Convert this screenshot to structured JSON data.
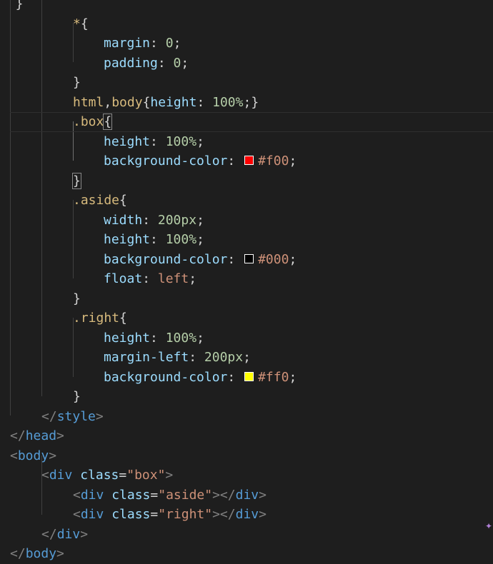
{
  "lines": [
    {
      "indent": 0,
      "tokens": [
        {
          "t": "  }",
          "c": "c-punc"
        }
      ],
      "partial": true
    },
    {
      "indent": 102,
      "tokens": [
        {
          "t": "*",
          "c": "c-sel"
        },
        {
          "t": "{",
          "c": "c-punc"
        }
      ]
    },
    {
      "indent": 145,
      "tokens": [
        {
          "t": "margin",
          "c": "c-prop"
        },
        {
          "t": ": ",
          "c": "c-punc"
        },
        {
          "t": "0",
          "c": "c-num"
        },
        {
          "t": ";",
          "c": "c-punc"
        }
      ]
    },
    {
      "indent": 145,
      "tokens": [
        {
          "t": "padding",
          "c": "c-prop"
        },
        {
          "t": ": ",
          "c": "c-punc"
        },
        {
          "t": "0",
          "c": "c-num"
        },
        {
          "t": ";",
          "c": "c-punc"
        }
      ]
    },
    {
      "indent": 102,
      "tokens": [
        {
          "t": "}",
          "c": "c-punc"
        }
      ]
    },
    {
      "indent": 102,
      "tokens": [
        {
          "t": "html",
          "c": "c-sel"
        },
        {
          "t": ",",
          "c": "c-punc"
        },
        {
          "t": "body",
          "c": "c-sel"
        },
        {
          "t": "{",
          "c": "c-punc"
        },
        {
          "t": "height",
          "c": "c-prop"
        },
        {
          "t": ": ",
          "c": "c-punc"
        },
        {
          "t": "100%",
          "c": "c-num"
        },
        {
          "t": ";}",
          "c": "c-punc"
        }
      ]
    },
    {
      "indent": 102,
      "current": true,
      "tokens": [
        {
          "t": ".box",
          "c": "c-sel"
        },
        {
          "t": "{",
          "c": "c-punc",
          "hl": true
        }
      ]
    },
    {
      "indent": 145,
      "tokens": [
        {
          "t": "height",
          "c": "c-prop"
        },
        {
          "t": ": ",
          "c": "c-punc"
        },
        {
          "t": "100%",
          "c": "c-num"
        },
        {
          "t": ";",
          "c": "c-punc"
        }
      ]
    },
    {
      "indent": 145,
      "tokens": [
        {
          "t": "background-color",
          "c": "c-prop"
        },
        {
          "t": ": ",
          "c": "c-punc"
        },
        {
          "swatch": "#ff0000"
        },
        {
          "t": "#f00",
          "c": "c-val"
        },
        {
          "t": ";",
          "c": "c-punc"
        }
      ]
    },
    {
      "indent": 102,
      "tokens": [
        {
          "t": "}",
          "c": "c-punc",
          "hl": true
        }
      ]
    },
    {
      "indent": 102,
      "tokens": [
        {
          "t": ".aside",
          "c": "c-sel"
        },
        {
          "t": "{",
          "c": "c-punc"
        }
      ]
    },
    {
      "indent": 145,
      "tokens": [
        {
          "t": "width",
          "c": "c-prop"
        },
        {
          "t": ": ",
          "c": "c-punc"
        },
        {
          "t": "200px",
          "c": "c-num"
        },
        {
          "t": ";",
          "c": "c-punc"
        }
      ]
    },
    {
      "indent": 145,
      "tokens": [
        {
          "t": "height",
          "c": "c-prop"
        },
        {
          "t": ": ",
          "c": "c-punc"
        },
        {
          "t": "100%",
          "c": "c-num"
        },
        {
          "t": ";",
          "c": "c-punc"
        }
      ]
    },
    {
      "indent": 145,
      "tokens": [
        {
          "t": "background-color",
          "c": "c-prop"
        },
        {
          "t": ": ",
          "c": "c-punc"
        },
        {
          "swatch": "#000000"
        },
        {
          "t": "#000",
          "c": "c-val"
        },
        {
          "t": ";",
          "c": "c-punc"
        }
      ]
    },
    {
      "indent": 145,
      "tokens": [
        {
          "t": "float",
          "c": "c-prop"
        },
        {
          "t": ": ",
          "c": "c-punc"
        },
        {
          "t": "left",
          "c": "c-val"
        },
        {
          "t": ";",
          "c": "c-punc"
        }
      ]
    },
    {
      "indent": 102,
      "tokens": [
        {
          "t": "}",
          "c": "c-punc"
        }
      ]
    },
    {
      "indent": 102,
      "tokens": [
        {
          "t": ".right",
          "c": "c-sel"
        },
        {
          "t": "{",
          "c": "c-punc"
        }
      ]
    },
    {
      "indent": 145,
      "tokens": [
        {
          "t": "height",
          "c": "c-prop"
        },
        {
          "t": ": ",
          "c": "c-punc"
        },
        {
          "t": "100%",
          "c": "c-num"
        },
        {
          "t": ";",
          "c": "c-punc"
        }
      ]
    },
    {
      "indent": 145,
      "tokens": [
        {
          "t": "margin-left",
          "c": "c-prop"
        },
        {
          "t": ": ",
          "c": "c-punc"
        },
        {
          "t": "200px",
          "c": "c-num"
        },
        {
          "t": ";",
          "c": "c-punc"
        }
      ]
    },
    {
      "indent": 145,
      "tokens": [
        {
          "t": "background-color",
          "c": "c-prop"
        },
        {
          "t": ": ",
          "c": "c-punc"
        },
        {
          "swatch": "#ffff00"
        },
        {
          "t": "#ff0",
          "c": "c-val"
        },
        {
          "t": ";",
          "c": "c-punc"
        }
      ]
    },
    {
      "indent": 102,
      "tokens": [
        {
          "t": "}",
          "c": "c-punc"
        }
      ]
    },
    {
      "indent": 58,
      "tokens": [
        {
          "t": "</",
          "c": "c-tagb"
        },
        {
          "t": "style",
          "c": "c-tag"
        },
        {
          "t": ">",
          "c": "c-tagb"
        }
      ]
    },
    {
      "indent": 14,
      "tokens": [
        {
          "t": "</",
          "c": "c-tagb"
        },
        {
          "t": "head",
          "c": "c-tag"
        },
        {
          "t": ">",
          "c": "c-tagb"
        }
      ]
    },
    {
      "indent": 14,
      "tokens": [
        {
          "t": "<",
          "c": "c-tagb"
        },
        {
          "t": "body",
          "c": "c-tag"
        },
        {
          "t": ">",
          "c": "c-tagb"
        }
      ]
    },
    {
      "indent": 58,
      "tokens": [
        {
          "t": "<",
          "c": "c-tagb"
        },
        {
          "t": "div",
          "c": "c-tag"
        },
        {
          "t": " ",
          "c": "c-text"
        },
        {
          "t": "class",
          "c": "c-attr"
        },
        {
          "t": "=",
          "c": "c-text"
        },
        {
          "t": "\"box\"",
          "c": "c-str"
        },
        {
          "t": ">",
          "c": "c-tagb"
        }
      ]
    },
    {
      "indent": 102,
      "tokens": [
        {
          "t": "<",
          "c": "c-tagb"
        },
        {
          "t": "div",
          "c": "c-tag"
        },
        {
          "t": " ",
          "c": "c-text"
        },
        {
          "t": "class",
          "c": "c-attr"
        },
        {
          "t": "=",
          "c": "c-text"
        },
        {
          "t": "\"aside\"",
          "c": "c-str"
        },
        {
          "t": "></",
          "c": "c-tagb"
        },
        {
          "t": "div",
          "c": "c-tag"
        },
        {
          "t": ">",
          "c": "c-tagb"
        }
      ]
    },
    {
      "indent": 102,
      "tokens": [
        {
          "t": "<",
          "c": "c-tagb"
        },
        {
          "t": "div",
          "c": "c-tag"
        },
        {
          "t": " ",
          "c": "c-text"
        },
        {
          "t": "class",
          "c": "c-attr"
        },
        {
          "t": "=",
          "c": "c-text"
        },
        {
          "t": "\"right\"",
          "c": "c-str"
        },
        {
          "t": "></",
          "c": "c-tagb"
        },
        {
          "t": "div",
          "c": "c-tag"
        },
        {
          "t": ">",
          "c": "c-tagb"
        }
      ]
    },
    {
      "indent": 58,
      "tokens": [
        {
          "t": "</",
          "c": "c-tagb"
        },
        {
          "t": "div",
          "c": "c-tag"
        },
        {
          "t": ">",
          "c": "c-tagb"
        }
      ]
    },
    {
      "indent": 14,
      "tokens": [
        {
          "t": "</",
          "c": "c-tagb"
        },
        {
          "t": "body",
          "c": "c-tag"
        },
        {
          "t": ">",
          "c": "c-tagb"
        }
      ],
      "partial": true
    }
  ],
  "colors": {
    "background": "#1e1e1e",
    "selector": "#d7ba7d",
    "property": "#9cdcfe",
    "number": "#b5cea8",
    "value": "#ce9178",
    "tag": "#569cd6",
    "tag_bracket": "#808080"
  }
}
